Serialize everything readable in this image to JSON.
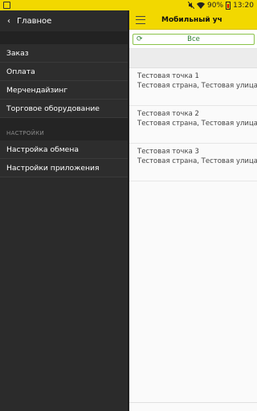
{
  "status_bar": {
    "battery": "90%",
    "time": "13:20",
    "icons": [
      "screenshot-icon",
      "mute-icon",
      "wifi-icon",
      "battery-icon"
    ]
  },
  "drawer": {
    "back_label": "Главное",
    "items": [
      {
        "label": "Заказ"
      },
      {
        "label": "Оплата"
      },
      {
        "label": "Мерчендайзинг"
      },
      {
        "label": "Торговое оборудование"
      }
    ],
    "section_title": "НАСТРОЙКИ",
    "settings_items": [
      {
        "label": "Настройка обмена"
      },
      {
        "label": "Настройки приложения"
      }
    ]
  },
  "main": {
    "title": "Мобильный уч",
    "filter_label": "Все",
    "points": [
      {
        "name": "Тестовая точка 1",
        "address": "Тестовая страна, Тестовая улица, д"
      },
      {
        "name": "Тестовая точка 2",
        "address": "Тестовая страна, Тестовая улица, д"
      },
      {
        "name": "Тестовая точка 3",
        "address": "Тестовая страна, Тестовая улица, д"
      }
    ]
  },
  "colors": {
    "accent": "#f2d800",
    "drawer_bg": "#2b2b2b",
    "filter_border": "#8bc34a",
    "filter_text": "#2e7d32"
  }
}
